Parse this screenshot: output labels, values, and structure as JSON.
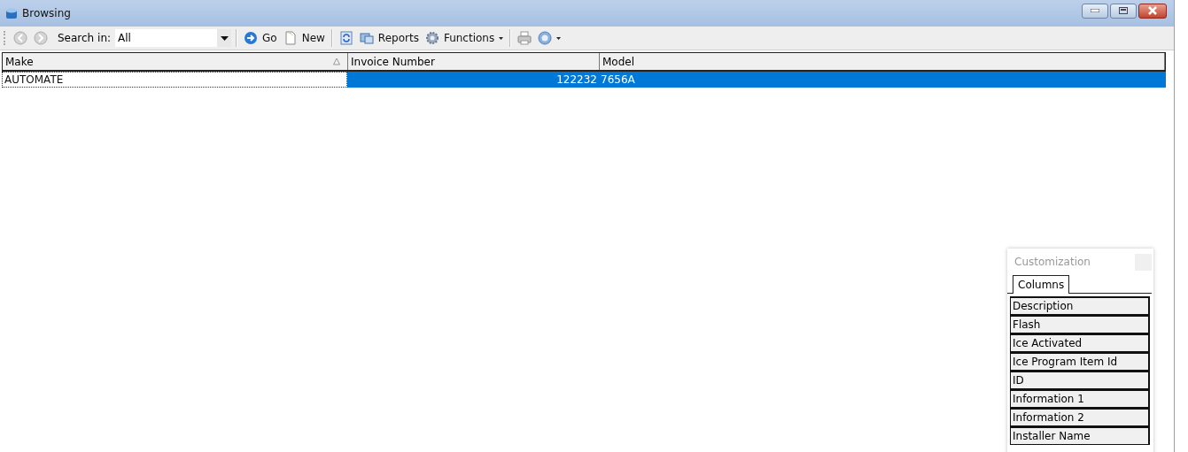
{
  "window": {
    "title": "Browsing"
  },
  "toolbar": {
    "search_label": "Search in:",
    "search_value": "All",
    "buttons": [
      {
        "kind": "go",
        "label": "Go"
      },
      {
        "kind": "new",
        "label": "New"
      },
      {
        "kind": "refresh"
      },
      {
        "kind": "reports",
        "label": "Reports"
      },
      {
        "kind": "functions",
        "label": "Functions"
      },
      {
        "kind": "print"
      },
      {
        "kind": "help"
      }
    ]
  },
  "table": {
    "columns": [
      {
        "label": "Make",
        "sorted": true,
        "numeric": false
      },
      {
        "label": "Invoice Number",
        "sorted": false,
        "numeric": true
      },
      {
        "label": "Model",
        "sorted": false,
        "numeric": false
      }
    ],
    "rows": [
      {
        "selected": true,
        "cells": [
          {
            "text": "AUTOMATE",
            "focused": true
          },
          {
            "text": "122232",
            "focused": false
          },
          {
            "text": "7656A",
            "focused": false
          }
        ]
      }
    ]
  },
  "customization": {
    "title": "Customization",
    "tabs": [
      {
        "label": "Columns",
        "selected": true
      }
    ],
    "items": [
      "Description",
      "Flash",
      "Ice Activated",
      "Ice Program Item Id",
      "ID",
      "Information 1",
      "Information 2",
      "Installer Name"
    ]
  }
}
